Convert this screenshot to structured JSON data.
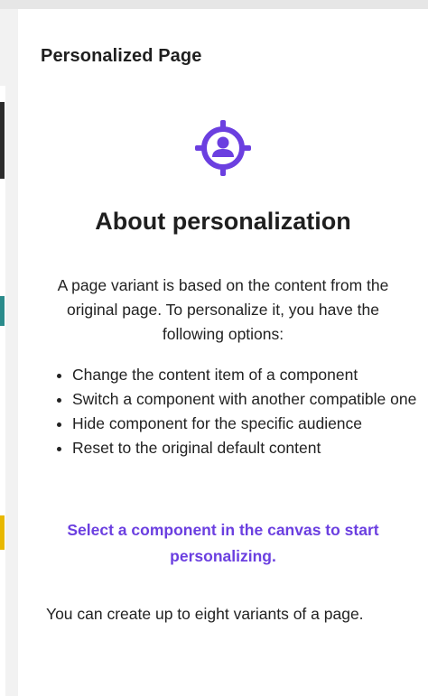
{
  "panel": {
    "title": "Personalized Page"
  },
  "icons": {
    "hero": "target-person-icon"
  },
  "colors": {
    "accent": "#6b3fe0",
    "text": "#222222"
  },
  "content": {
    "heading": "About personalization",
    "intro": "A page variant is based on the content from the original page. To personalize it, you have the following options:",
    "options": [
      "Change the content item of a component",
      "Switch a component with another compatible one",
      "Hide component for the specific audience",
      "Reset to the original default content"
    ],
    "cta": "Select a component in the canvas to start personalizing.",
    "footnote": "You can create up to eight variants of a page."
  }
}
